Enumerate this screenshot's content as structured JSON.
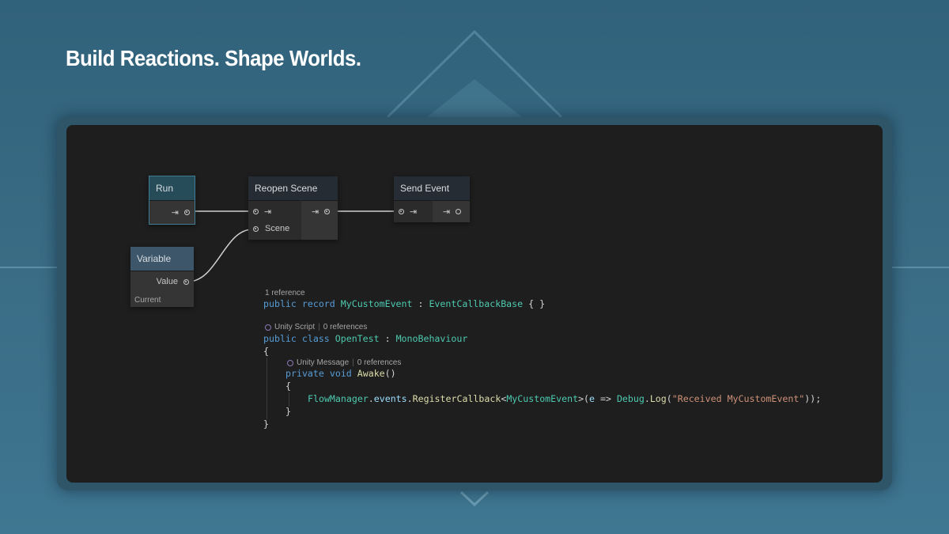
{
  "headline": "Build Reactions. Shape Worlds.",
  "graph": {
    "run": {
      "title": "Run"
    },
    "reopen": {
      "title": "Reopen Scene",
      "input_label": "Scene"
    },
    "send": {
      "title": "Send Event"
    },
    "variable": {
      "title": "Variable",
      "output_label": "Value",
      "footer": "Current"
    }
  },
  "code": {
    "lens1": "1 reference",
    "line1": {
      "kw1": "public",
      "kw2": "record",
      "name": "MyCustomEvent",
      "colon": " : ",
      "base": "EventCallbackBase",
      "tail": " { }"
    },
    "lens2": {
      "tag": "Unity Script",
      "sep": "|",
      "refs": "0 references"
    },
    "line2": {
      "kw1": "public",
      "kw2": "class",
      "name": "OpenTest",
      "colon": " : ",
      "base": "MonoBehaviour"
    },
    "open_brace": "{",
    "lens3": {
      "tag": "Unity Message",
      "sep": "|",
      "refs": "0 references"
    },
    "line3": {
      "kw1": "private",
      "kw2": "void",
      "name": "Awake",
      "tail": "()"
    },
    "inner_open": "{",
    "line4": {
      "cls": "FlowManager",
      "dot1": ".",
      "member": "events",
      "dot2": ".",
      "method": "RegisterCallback",
      "lt": "<",
      "generic": "MyCustomEvent",
      "gt": ">(",
      "param": "e",
      "arrow": " => ",
      "cls2": "Debug",
      "dot3": ".",
      "method2": "Log",
      "paren": "(",
      "string": "\"Received MyCustomEvent\"",
      "end": "));"
    },
    "inner_close": "}",
    "close_brace": "}"
  }
}
